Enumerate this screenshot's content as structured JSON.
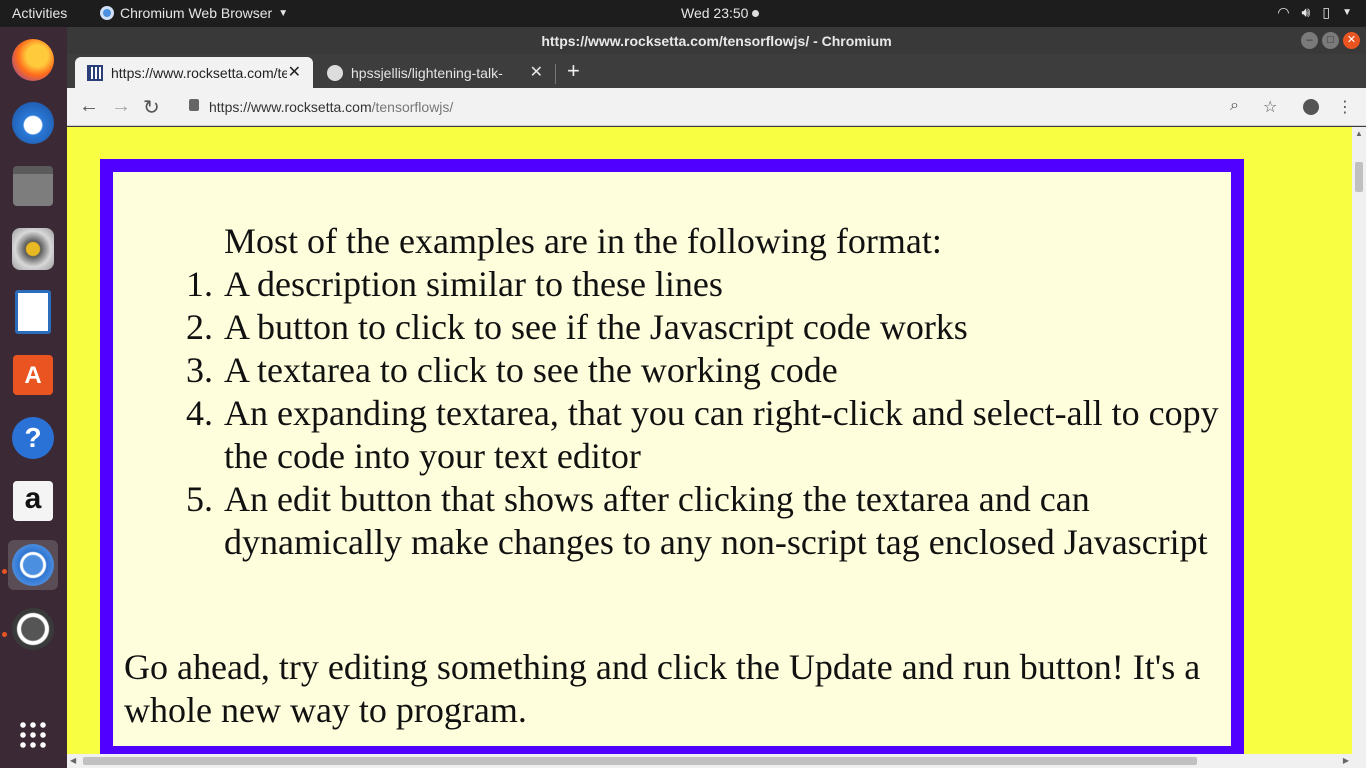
{
  "topbar": {
    "activities": "Activities",
    "app_menu": "Chromium Web Browser",
    "clock": "Wed 23:50"
  },
  "dock": {
    "items": [
      {
        "icon": "firefox-icon"
      },
      {
        "icon": "thunderbird-icon"
      },
      {
        "icon": "files-icon"
      },
      {
        "icon": "rhythmbox-icon"
      },
      {
        "icon": "libreoffice-writer-icon"
      },
      {
        "icon": "software-center-icon"
      },
      {
        "icon": "help-icon"
      },
      {
        "icon": "amazon-icon"
      },
      {
        "icon": "chromium-icon"
      },
      {
        "icon": "software-updater-icon"
      },
      {
        "icon": "show-apps-icon"
      }
    ]
  },
  "window": {
    "title": "https://www.rocksetta.com/tensorflowjs/ - Chromium"
  },
  "tabs": [
    {
      "label": "https://www.rocksetta.com/tensorflowjs/",
      "active": true
    },
    {
      "label": "hpssjellis/lightening-talk-",
      "active": false
    }
  ],
  "omnibox": {
    "url_host": "https://www.rocksetta.com",
    "url_path": "/tensorflowjs/"
  },
  "page": {
    "intro": "Most of the examples are in the following format:",
    "steps": [
      {
        "num": "1.",
        "text": "A description similar to these lines"
      },
      {
        "num": "2.",
        "text": "A button to click to see if the Javascript code works"
      },
      {
        "num": "3.",
        "text": "A textarea to click to see the working code"
      },
      {
        "num": "4.",
        "text": "An expanding textarea, that you can right-click and select-all to copy the code into your text editor"
      },
      {
        "num": "5.",
        "text": "An edit button that shows after clicking the textarea and can dynamically make changes to any non-script tag enclosed Javascript"
      }
    ],
    "outro": "Go ahead, try editing something and click the Update and run button! It's a whole new way to program."
  },
  "colors": {
    "page_bg": "#f8fe42",
    "box_border": "#5000ff",
    "box_bg": "#fefedd"
  }
}
